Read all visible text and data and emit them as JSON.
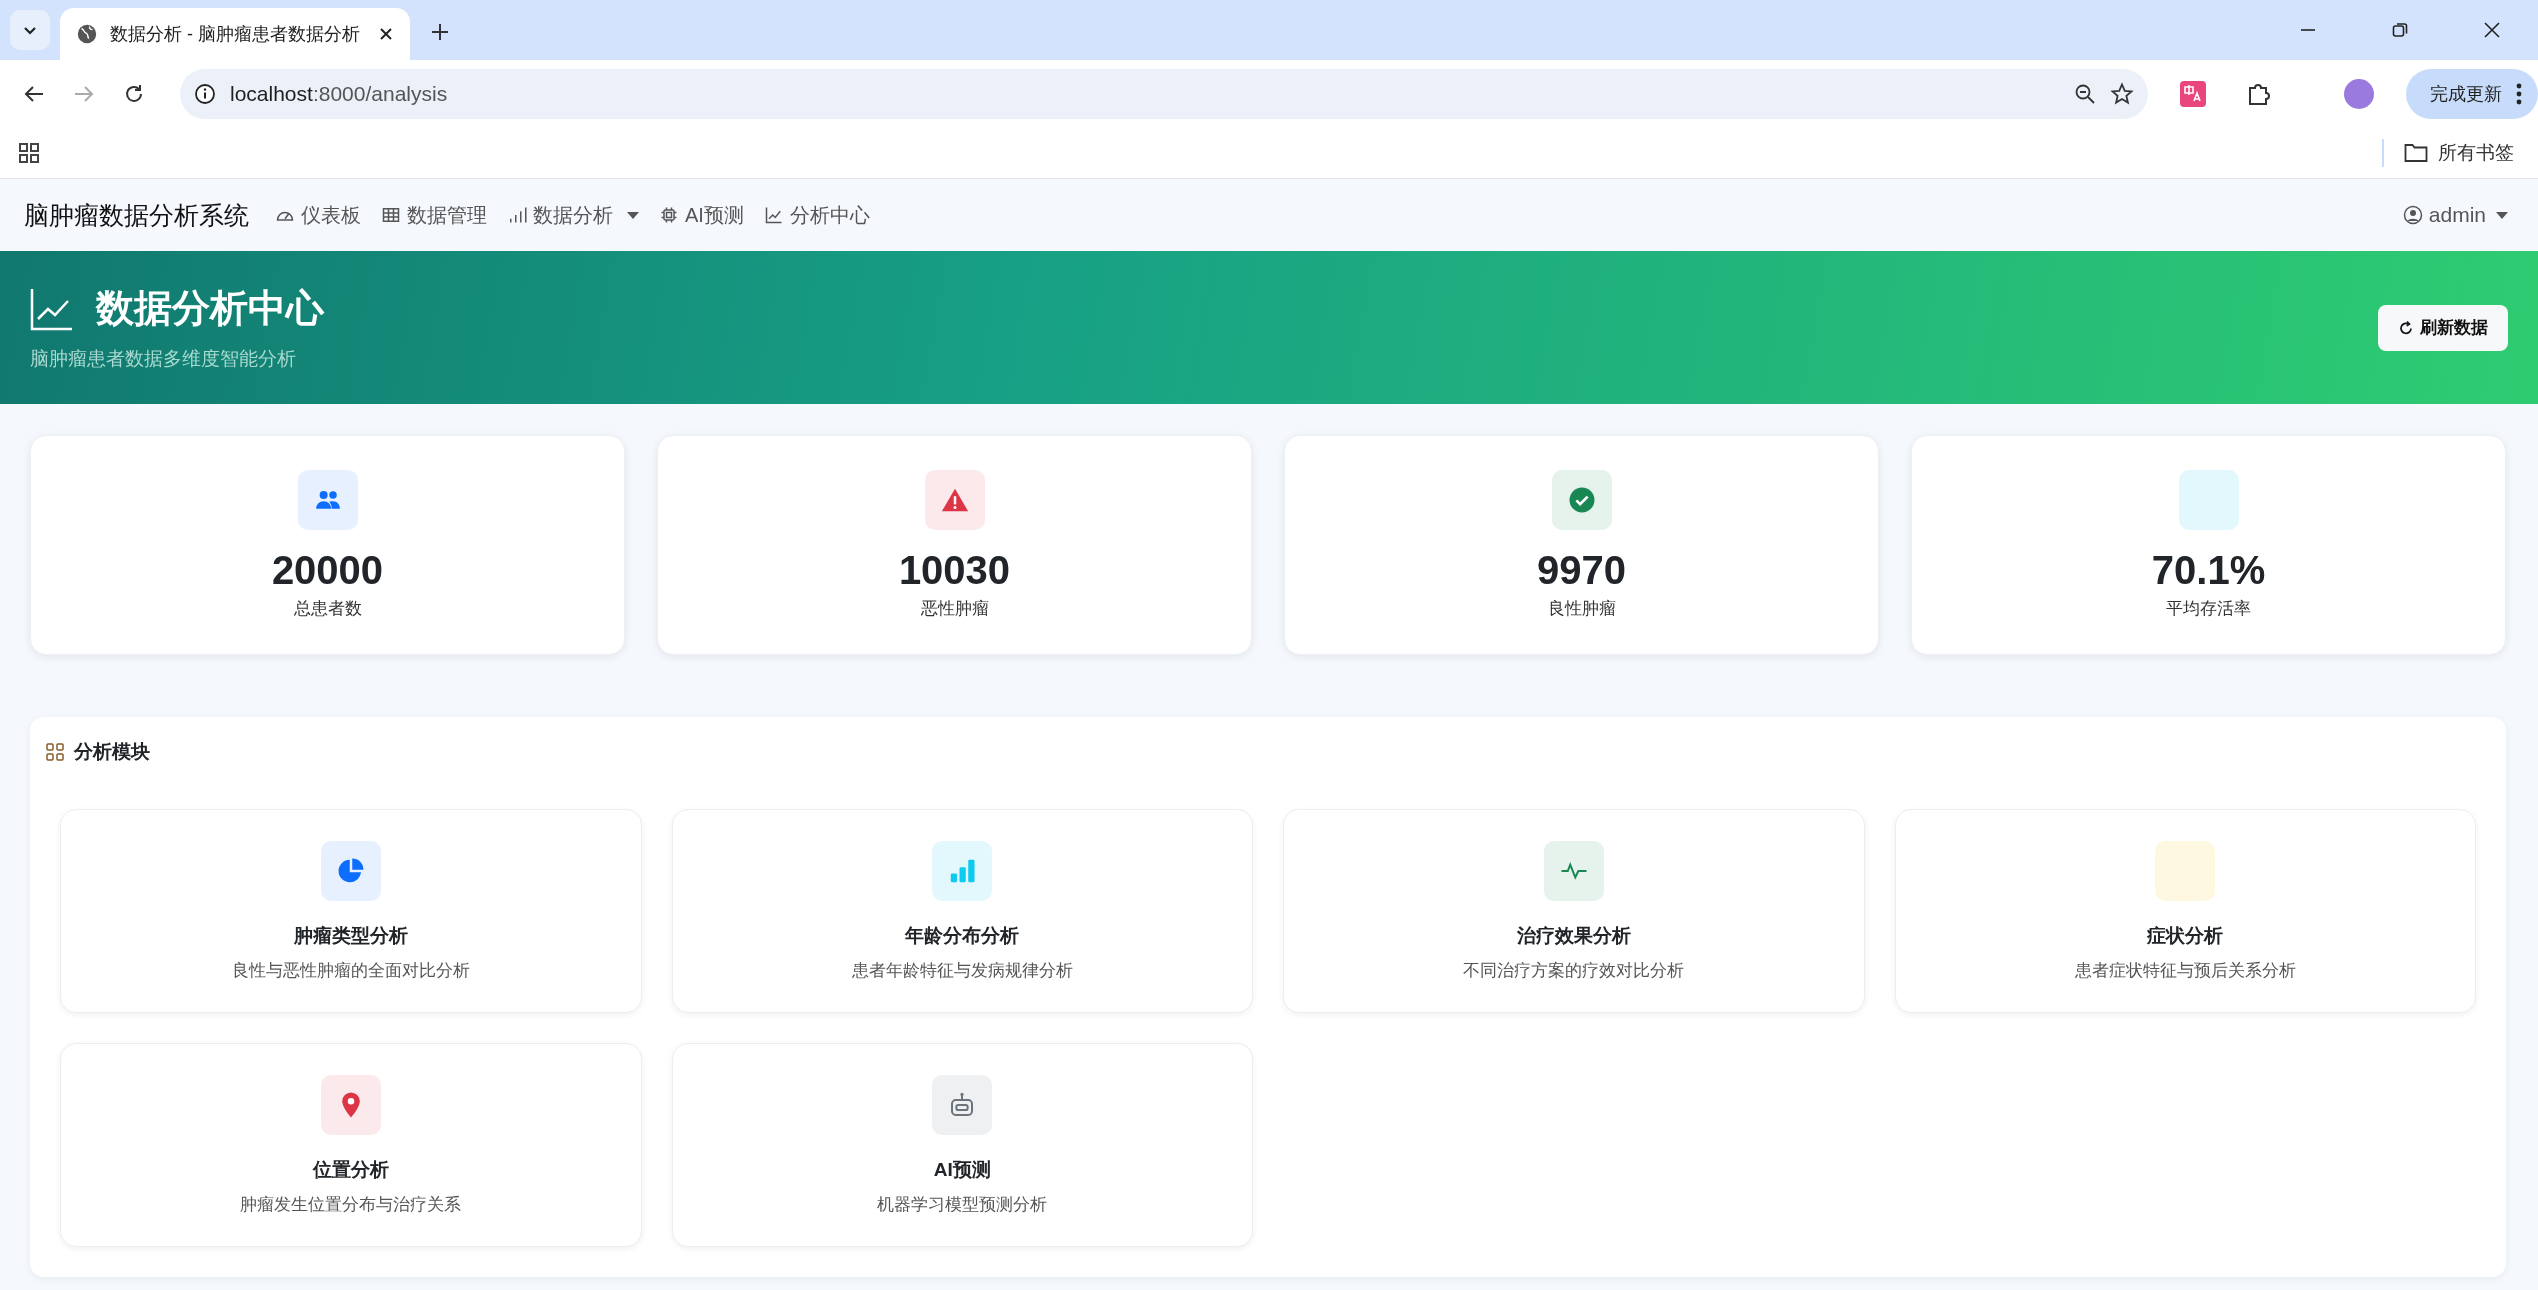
{
  "browser": {
    "tab_title": "数据分析 - 脑肿瘤患者数据分析",
    "url_host": "localhost",
    "url_rest": ":8000/analysis",
    "update_button": "完成更新",
    "bookmarks_folder": "所有书签"
  },
  "navbar": {
    "brand": "脑肿瘤数据分析系统",
    "items": [
      {
        "label": "仪表板",
        "kind": "gauge",
        "dropdown": false
      },
      {
        "label": "数据管理",
        "kind": "table",
        "dropdown": false
      },
      {
        "label": "数据分析",
        "kind": "bars",
        "dropdown": true
      },
      {
        "label": "AI预测",
        "kind": "chip",
        "dropdown": false
      },
      {
        "label": "分析中心",
        "kind": "trend",
        "dropdown": false
      }
    ],
    "user": "admin"
  },
  "header": {
    "title": "数据分析中心",
    "subtitle": "脑肿瘤患者数据多维度智能分析",
    "refresh_button": "刷新数据"
  },
  "stats": [
    {
      "value": "20000",
      "label": "总患者数",
      "kind": "people",
      "color": "#e7f0fe"
    },
    {
      "value": "10030",
      "label": "恶性肿瘤",
      "kind": "warning",
      "color": "#fbe9eb"
    },
    {
      "value": "9970",
      "label": "良性肿瘤",
      "kind": "check",
      "color": "#e6f2ec"
    },
    {
      "value": "70.1%",
      "label": "平均存活率",
      "kind": "blank",
      "color": "#e3f8fd"
    }
  ],
  "modules": {
    "title": "分析模块",
    "items": [
      {
        "title": "肿瘤类型分析",
        "description": "良性与恶性肿瘤的全面对比分析",
        "kind": "pie",
        "color": "#e7f0fe"
      },
      {
        "title": "年龄分布分析",
        "description": "患者年龄特征与发病规律分析",
        "kind": "bars",
        "color": "#e3f8fd"
      },
      {
        "title": "治疗效果分析",
        "description": "不同治疗方案的疗效对比分析",
        "kind": "pulse",
        "color": "#e6f2ec"
      },
      {
        "title": "症状分析",
        "description": "患者症状特征与预后关系分析",
        "kind": "blank",
        "color": "#fff8e1"
      },
      {
        "title": "位置分析",
        "description": "肿瘤发生位置分布与治疗关系",
        "kind": "pin",
        "color": "#fbe9eb"
      },
      {
        "title": "AI预测",
        "description": "机器学习模型预测分析",
        "kind": "robot",
        "color": "#eff0f1"
      }
    ]
  }
}
